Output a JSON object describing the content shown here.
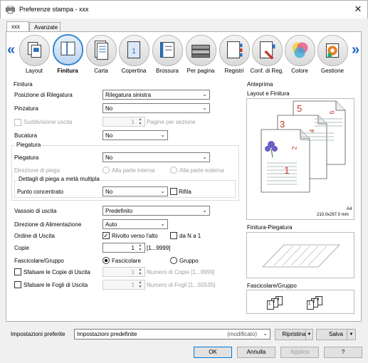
{
  "window": {
    "title": "Preferenze stampa - xxx",
    "close": "✕"
  },
  "tabs": [
    "xxx",
    "Avanzate"
  ],
  "nav": {
    "prev": "«",
    "next": "»",
    "items": [
      {
        "label": "Layout",
        "icon": "layout-icon"
      },
      {
        "label": "Finitura",
        "icon": "finishing-icon",
        "selected": true
      },
      {
        "label": "Carta",
        "icon": "paper-icon"
      },
      {
        "label": "Copertina",
        "icon": "cover-icon"
      },
      {
        "label": "Brossura",
        "icon": "perfect-binding-icon"
      },
      {
        "label": "Per pagina",
        "icon": "per-page-icon"
      },
      {
        "label": "Registri",
        "icon": "tabs-icon"
      },
      {
        "label": "Conf. di Reg.",
        "icon": "register-settings-icon"
      },
      {
        "label": "Colore",
        "icon": "color-icon"
      },
      {
        "label": "Gestione",
        "icon": "management-icon"
      }
    ]
  },
  "finitura": {
    "section": "Finitura",
    "binding_position": {
      "label": "Posizione di Rilegatura",
      "value": "Rilegatura sinistra"
    },
    "stapling": {
      "label": "Pinzatura",
      "value": "No"
    },
    "split_output": {
      "label": "Suddivisione uscita",
      "value": "1",
      "unit": "Pagine per sezione"
    },
    "punching": {
      "label": "Bucatura",
      "value": "No"
    },
    "folding_section": "Piegatura",
    "folding": {
      "label": "Piegatura",
      "value": "No"
    },
    "fold_direction": {
      "label": "Direzione di piega",
      "opt1": "Alla parte interna",
      "opt2": "Alla parte esterna"
    },
    "half_fold_section": "Dettagli di piega a metà multipla",
    "focus_point": {
      "label": "Punto concentrato",
      "value": "No",
      "trim_label": "Rifila"
    },
    "output_tray": {
      "label": "Vassoio di uscita",
      "value": "Predefinito"
    },
    "feed_direction": {
      "label": "Direzione di Alimentazione",
      "value": "Auto"
    },
    "output_order": {
      "label": "Ordine di Uscita",
      "face_up": "Rivolto verso l'alto",
      "n_to_1": "da N a 1"
    },
    "copies": {
      "label": "Copie",
      "value": "1",
      "range": "[1...9999]"
    },
    "collate": {
      "label": "Fascicolare/Gruppo",
      "opt1": "Fascicolare",
      "opt2": "Gruppo"
    },
    "offset_copies": {
      "label": "Sfalsare le Copie di Uscita",
      "value": "1",
      "hint": "Numero di Copie [1...9999]"
    },
    "offset_sheets": {
      "label": "Sfalsare le Fogli di Uscita",
      "value": "1",
      "hint": "Numero di Fogli [1...65535]"
    }
  },
  "preview": {
    "title": "Anteprima",
    "layout_title": "Layout e Finitura",
    "page_numbers": [
      "1",
      "2",
      "3",
      "4",
      "5",
      "6"
    ],
    "paper_size": "A4",
    "paper_dims": "210.0x297.0 mm",
    "fold_title": "Finitura-Piegatura",
    "collate_title": "Fascicolare/Gruppo",
    "collate_nums": [
      "1",
      "2",
      "3"
    ]
  },
  "footer": {
    "preset_label": "Impostazioni preferite",
    "preset_value": "Impostazioni predefinite",
    "preset_modified": "(modificato)",
    "restore": "Ripristina",
    "save": "Salva",
    "ok": "OK",
    "cancel": "Annulla",
    "apply": "Applica",
    "help": "?"
  },
  "colors": {
    "accent": "#0078d7",
    "nav_arrow": "#1c64c0",
    "page_number": "#c0392b"
  }
}
